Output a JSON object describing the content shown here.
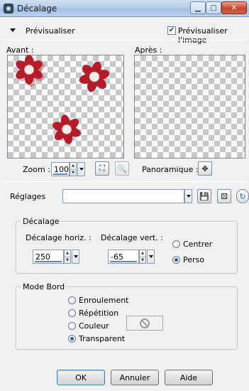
{
  "window": {
    "title": "Décalage"
  },
  "preview": {
    "toggle_label": "Prévisualiser",
    "show_image_label": "Prévisualiser l'image",
    "show_image_checked": true,
    "before_label": "Avant :",
    "after_label": "Après :",
    "zoom_label": "Zoom :",
    "zoom_value": "100",
    "pan_label": "Panoramique :"
  },
  "presets": {
    "label": "Réglages",
    "value": ""
  },
  "offset": {
    "group_label": "Décalage",
    "horiz_label": "Décalage horiz. :",
    "horiz_value": "250",
    "vert_label": "Décalage vert. :",
    "vert_value": "-65",
    "center_label": "Centrer",
    "custom_label": "Perso",
    "selected": "Perso"
  },
  "edge_mode": {
    "group_label": "Mode Bord",
    "options": [
      "Enroulement",
      "Répétition",
      "Couleur",
      "Transparent"
    ],
    "selected": "Transparent"
  },
  "buttons": {
    "ok": "OK",
    "cancel": "Annuler",
    "help": "Aide"
  },
  "colors": {
    "flower_red": "#b51c2a",
    "flower_center": "#f4ece6"
  }
}
